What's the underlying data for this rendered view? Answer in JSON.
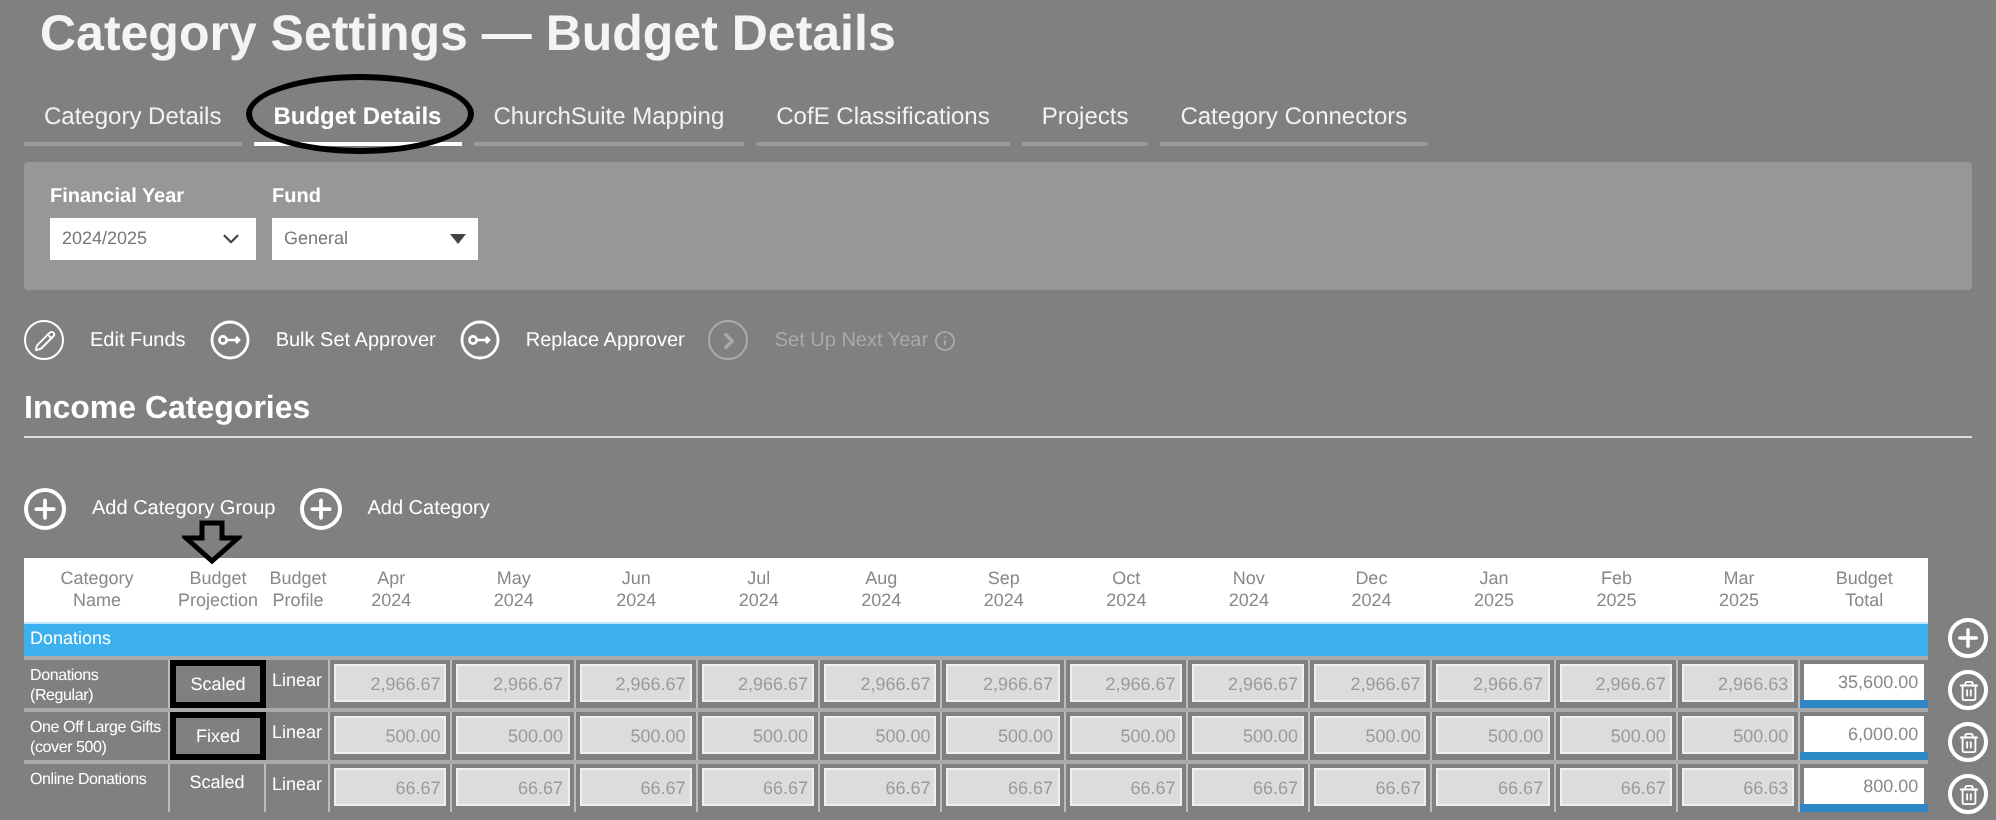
{
  "title": "Category Settings — Budget Details",
  "tabs": [
    {
      "label": "Category Details",
      "selected": false,
      "circled": false
    },
    {
      "label": "Budget Details",
      "selected": true,
      "circled": true
    },
    {
      "label": "ChurchSuite Mapping",
      "selected": false,
      "circled": false
    },
    {
      "label": "CofE Classifications",
      "selected": false,
      "circled": false
    },
    {
      "label": "Projects",
      "selected": false,
      "circled": false
    },
    {
      "label": "Category Connectors",
      "selected": false,
      "circled": false
    }
  ],
  "filters": [
    {
      "label": "Financial Year",
      "value": "2024/2025",
      "kind": "chevron"
    },
    {
      "label": "Fund",
      "value": "General",
      "kind": "caret"
    }
  ],
  "actions": [
    {
      "label": "Edit Funds",
      "kind": "edit",
      "disabled": false
    },
    {
      "label": "Bulk Set Approver",
      "kind": "key",
      "disabled": false
    },
    {
      "label": "Replace Approver",
      "kind": "key",
      "disabled": false
    },
    {
      "label": "Set Up Next Year",
      "kind": "next",
      "disabled": true,
      "info": true
    }
  ],
  "section_title": "Income Categories",
  "add_buttons": [
    {
      "label": "Add Category Group"
    },
    {
      "label": "Add Category"
    }
  ],
  "table": {
    "columns": [
      "Category Name",
      "Budget Projection",
      "Budget Profile",
      "Apr 2024",
      "May 2024",
      "Jun 2024",
      "Jul 2024",
      "Aug 2024",
      "Sep 2024",
      "Oct 2024",
      "Nov 2024",
      "Dec 2024",
      "Jan 2025",
      "Feb 2025",
      "Mar 2025",
      "Budget Total"
    ],
    "groups": [
      {
        "name": "Donations",
        "rows": [
          {
            "name": "Donations (Regular)",
            "projection": "Scaled",
            "profile": "Linear",
            "highlighted": true,
            "values": [
              "2,966.67",
              "2,966.67",
              "2,966.67",
              "2,966.67",
              "2,966.67",
              "2,966.67",
              "2,966.67",
              "2,966.67",
              "2,966.67",
              "2,966.67",
              "2,966.67",
              "2,966.63"
            ],
            "total": "35,600.00"
          },
          {
            "name": "One Off Large Gifts (cover 500)",
            "projection": "Fixed",
            "profile": "Linear",
            "highlighted": true,
            "values": [
              "500.00",
              "500.00",
              "500.00",
              "500.00",
              "500.00",
              "500.00",
              "500.00",
              "500.00",
              "500.00",
              "500.00",
              "500.00",
              "500.00"
            ],
            "total": "6,000.00"
          },
          {
            "name": "Online Donations",
            "projection": "Scaled",
            "profile": "Linear",
            "highlighted": false,
            "values": [
              "66.67",
              "66.67",
              "66.67",
              "66.67",
              "66.67",
              "66.67",
              "66.67",
              "66.67",
              "66.67",
              "66.67",
              "66.67",
              "66.63"
            ],
            "total": "800.00"
          }
        ]
      }
    ]
  },
  "pointer_arrow": true
}
